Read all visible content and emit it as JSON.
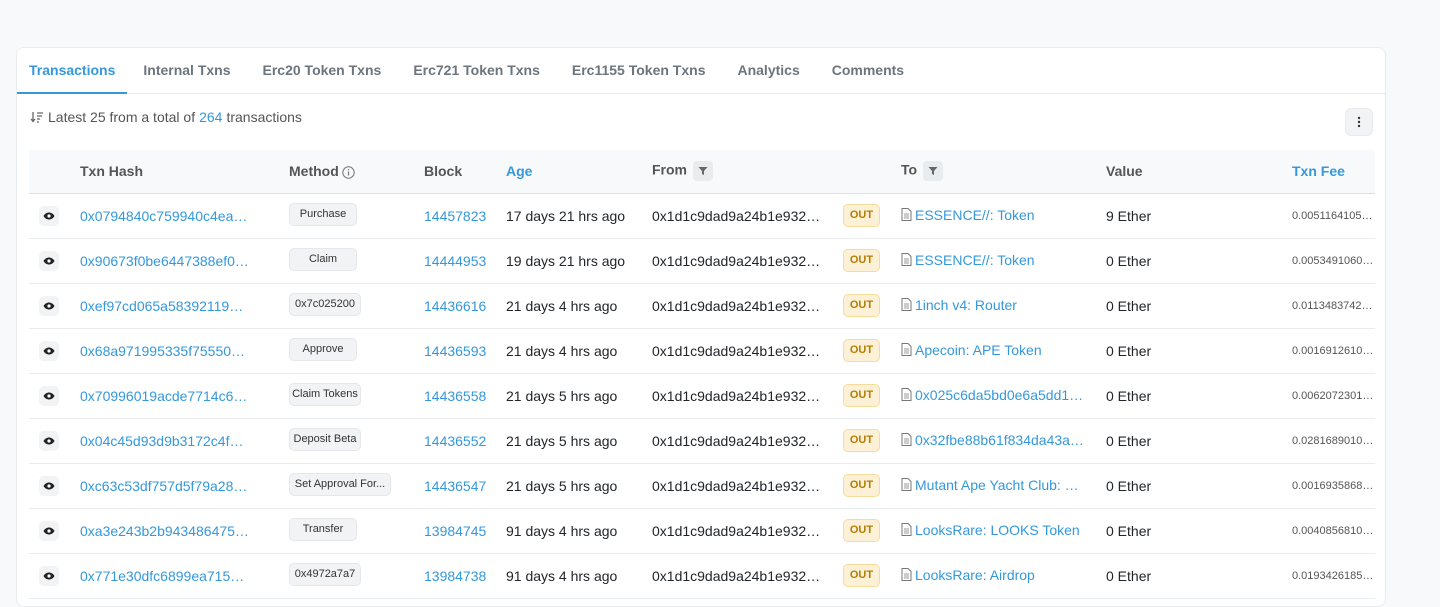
{
  "tabs": [
    {
      "label": "Transactions"
    },
    {
      "label": "Internal Txns"
    },
    {
      "label": "Erc20 Token Txns"
    },
    {
      "label": "Erc721 Token Txns"
    },
    {
      "label": "Erc1155 Token Txns"
    },
    {
      "label": "Analytics"
    },
    {
      "label": "Comments"
    }
  ],
  "summary": {
    "prefix": "Latest 25 from a total of",
    "count": "264",
    "suffix": "transactions"
  },
  "columns": {
    "txn_hash": "Txn Hash",
    "method": "Method",
    "block": "Block",
    "age": "Age",
    "from": "From",
    "to": "To",
    "value": "Value",
    "txn_fee": "Txn Fee"
  },
  "rows": [
    {
      "hash": "0x0794840c759940c4ea…",
      "method": "Purchase",
      "block": "14457823",
      "age": "17 days 21 hrs ago",
      "from": "0x1d1c9dad9a24b1e932…",
      "direction": "OUT",
      "to": "ESSENCE//: Token",
      "value": "9 Ether",
      "fee": "0.00511641053727"
    },
    {
      "hash": "0x90673f0be6447388ef0…",
      "method": "Claim",
      "block": "14444953",
      "age": "19 days 21 hrs ago",
      "from": "0x1d1c9dad9a24b1e932…",
      "direction": "OUT",
      "to": "ESSENCE//: Token",
      "value": "0 Ether",
      "fee": "0.00534910609412"
    },
    {
      "hash": "0xef97cd065a58392119…",
      "method": "0x7c025200",
      "block": "14436616",
      "age": "21 days 4 hrs ago",
      "from": "0x1d1c9dad9a24b1e932…",
      "direction": "OUT",
      "to": "1inch v4: Router",
      "value": "0 Ether",
      "fee": "0.01134837420301"
    },
    {
      "hash": "0x68a971995335f75550…",
      "method": "Approve",
      "block": "14436593",
      "age": "21 days 4 hrs ago",
      "from": "0x1d1c9dad9a24b1e932…",
      "direction": "OUT",
      "to": "Apecoin: APE Token",
      "value": "0 Ether",
      "fee": "0.00169126104121"
    },
    {
      "hash": "0x70996019acde7714c6…",
      "method": "Claim Tokens",
      "block": "14436558",
      "age": "21 days 5 hrs ago",
      "from": "0x1d1c9dad9a24b1e932…",
      "direction": "OUT",
      "to": "0x025c6da5bd0e6a5dd1…",
      "value": "0 Ether",
      "fee": "0.00620723018612"
    },
    {
      "hash": "0x04c45d93d9b3172c4f…",
      "method": "Deposit Beta",
      "block": "14436552",
      "age": "21 days 5 hrs ago",
      "from": "0x1d1c9dad9a24b1e932…",
      "direction": "OUT",
      "to": "0x32fbe88b61f834da43a…",
      "value": "0 Ether",
      "fee": "0.02816890100901"
    },
    {
      "hash": "0xc63c53df757d5f79a28…",
      "method": "Set Approval For...",
      "block": "14436547",
      "age": "21 days 5 hrs ago",
      "from": "0x1d1c9dad9a24b1e932…",
      "direction": "OUT",
      "to": "Mutant Ape Yacht Club: …",
      "value": "0 Ether",
      "fee": "0.00169358686112"
    },
    {
      "hash": "0xa3e243b2b943486475…",
      "method": "Transfer",
      "block": "13984745",
      "age": "91 days 4 hrs ago",
      "from": "0x1d1c9dad9a24b1e932…",
      "direction": "OUT",
      "to": "LooksRare: LOOKS Token",
      "value": "0 Ether",
      "fee": "0.00408568102412"
    },
    {
      "hash": "0x771e30dfc6899ea715…",
      "method": "0x4972a7a7",
      "block": "13984738",
      "age": "91 days 4 hrs ago",
      "from": "0x1d1c9dad9a24b1e932…",
      "direction": "OUT",
      "to": "LooksRare: Airdrop",
      "value": "0 Ether",
      "fee": "0.01934261858212"
    }
  ]
}
